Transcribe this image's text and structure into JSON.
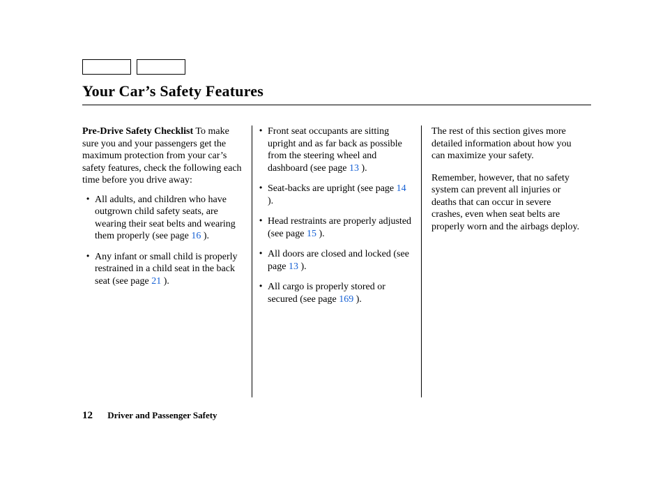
{
  "title": "Your Car’s Safety Features",
  "col1": {
    "subhead": "Pre-Drive Safety Checklist",
    "intro": "To make sure you and your passengers get the maximum protection from your car’s safety features, check the following each time before you drive away:",
    "items": [
      {
        "text_before": "All adults, and children who have outgrown child safety seats, are wearing their seat belts and wearing them properly (see page ",
        "pageref": "16",
        "text_after": " )."
      },
      {
        "text_before": "Any infant or small child is properly restrained in a child seat in the back seat (see page ",
        "pageref": "21",
        "text_after": " )."
      }
    ]
  },
  "col2": {
    "items": [
      {
        "text_before": "Front seat occupants are sitting upright and as far back as possible from the steering wheel and dashboard (see page ",
        "pageref": "13",
        "text_after": " )."
      },
      {
        "text_before": "Seat-backs are upright (see page ",
        "pageref": "14",
        "text_after": " )."
      },
      {
        "text_before": "Head restraints are properly adjusted (see page ",
        "pageref": "15",
        "text_after": " )."
      },
      {
        "text_before": "All doors are closed and locked (see page ",
        "pageref": "13",
        "text_after": " )."
      },
      {
        "text_before": "All cargo is properly stored or secured (see page ",
        "pageref": "169",
        "text_after": " )."
      }
    ]
  },
  "col3": {
    "p1": "The rest of this section gives more detailed information about how you can maximize your safety.",
    "p2": "Remember, however, that no safety system can prevent all injuries or deaths that can occur in severe crashes, even when seat belts are properly worn and the airbags deploy."
  },
  "footer": {
    "pagenum": "12",
    "section": "Driver and Passenger Safety"
  }
}
